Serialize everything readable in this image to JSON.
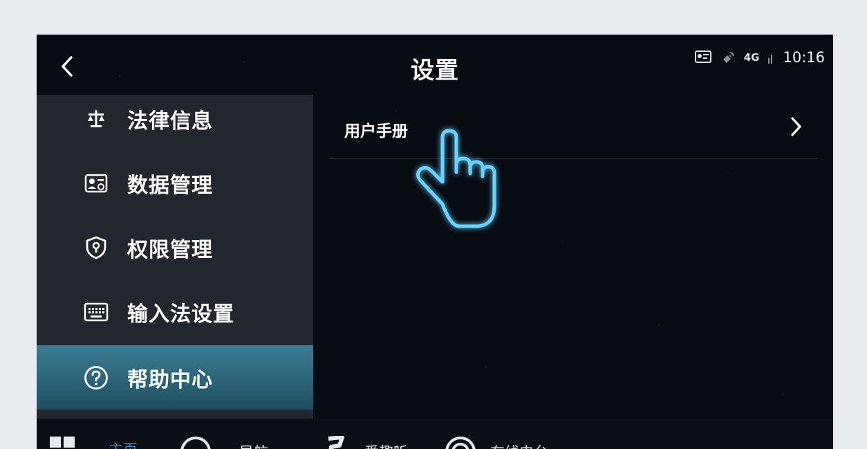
{
  "header": {
    "title": "设置",
    "status": {
      "network": "4G",
      "time": "10:16"
    }
  },
  "sidebar": {
    "items": [
      {
        "label": "法律信息",
        "icon": "scale-icon",
        "active": false
      },
      {
        "label": "数据管理",
        "icon": "data-card-icon",
        "active": false
      },
      {
        "label": "权限管理",
        "icon": "shield-icon",
        "active": false
      },
      {
        "label": "输入法设置",
        "icon": "keyboard-icon",
        "active": false
      },
      {
        "label": "帮助中心",
        "icon": "help-circle-icon",
        "active": true
      }
    ]
  },
  "main": {
    "items": [
      {
        "label": "用户手册"
      }
    ]
  },
  "dock": {
    "items": [
      {
        "label": "主页",
        "icon": "apps-grid-icon",
        "active": true
      },
      {
        "label": "导航",
        "icon": "navigation-icon",
        "active": false
      },
      {
        "label": "爱趣听",
        "icon": "music-icon",
        "active": false
      },
      {
        "label": "在线电台",
        "icon": "radio-icon",
        "active": false
      }
    ]
  },
  "colors": {
    "accent": "#3a87c9",
    "active_item": "#2f6b80",
    "background": "#070b12",
    "sidebar": "#22272d",
    "glow": "#4fc3ff"
  }
}
